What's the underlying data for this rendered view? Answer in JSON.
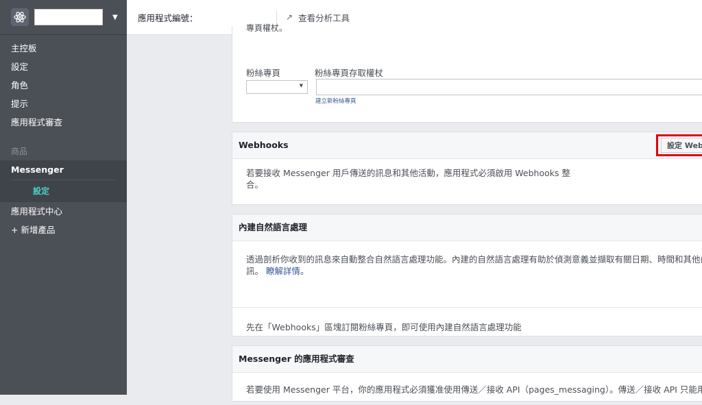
{
  "sidebar": {
    "app_icon": "atom-icon",
    "caret": "▼",
    "items": [
      "主控板",
      "設定",
      "角色",
      "提示",
      "應用程式審查"
    ],
    "section_label": "商品",
    "product": "Messenger",
    "product_sub": "設定",
    "items_after": [
      "應用程式中心",
      "+ 新增產品"
    ]
  },
  "topbar": {
    "app_id_label": "應用程式編號：",
    "analytics_icon": "trend-arrow-icon",
    "analytics_arrow": "↗",
    "analytics_label": "查看分析工具"
  },
  "token_card": {
    "cut_text": "專頁權杖。",
    "page_label": "粉絲專頁",
    "token_label": "粉絲專頁存取權杖",
    "dropdown_arrow": "▼",
    "create_page_link": "建立新粉絲專頁"
  },
  "webhooks_card": {
    "title": "Webhooks",
    "button_label": "設定 Webh",
    "body_line1": "若要接收 Messenger 用戶傳送的訊息和其他活動，應用程式必須啟用 Webhooks 整",
    "body_line2": "合。"
  },
  "nlp_card": {
    "title": "內建自然語言處理",
    "body_line1": "透過剖析你收到的訊息來自動整合自然語言處理功能。內建的自然語言處理有助於偵測意義並擷取有關日期、時間和其他內容的",
    "body_line2_prefix": "訊。",
    "learn_more": "瞭解詳情",
    "body_line2_suffix": "。",
    "footer_text": "先在「Webhooks」區塊訂閱粉絲專頁，即可使用內建自然語言處理功能"
  },
  "review_card": {
    "title": "Messenger 的應用程式審查",
    "body": "若要使用 Messenger 平台，你的應用程式必須獲准使用傳送／接收 API（pages_messaging）。傳送／接收 API 只能用來傳"
  },
  "colors": {
    "sidebar_bg": "#4b4f56",
    "active_sub": "#4cd0c4",
    "highlight": "#e0000b",
    "link": "#365899"
  }
}
